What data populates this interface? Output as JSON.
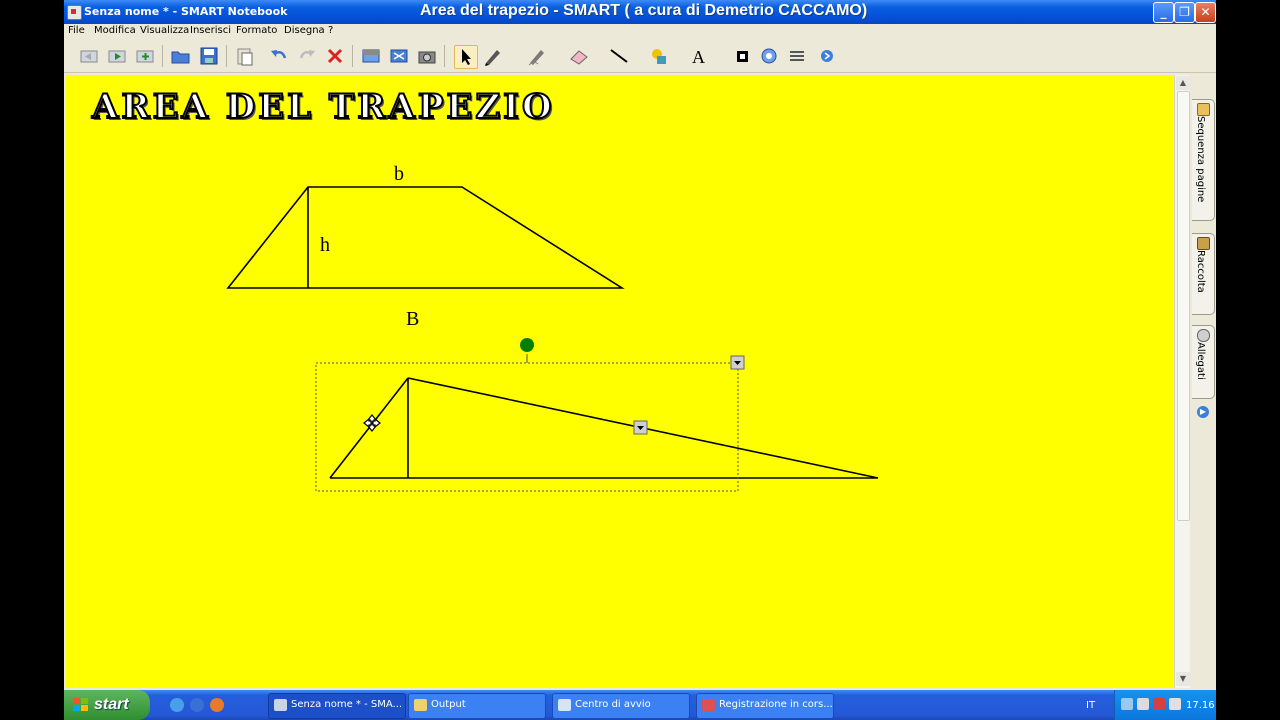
{
  "window": {
    "app_title": "Senza nome * - SMART Notebook",
    "title": "Area del trapezio - SMART ( a cura di Demetrio CACCAMO)",
    "controls": [
      "minimize",
      "maximize",
      "close"
    ]
  },
  "menu": [
    "File",
    "Modifica",
    "Visualizza",
    "Inserisci",
    "Formato",
    "Disegna",
    "?"
  ],
  "toolbar": {
    "icons": [
      "previous-page-icon",
      "next-page-icon",
      "add-page-icon",
      "open-icon",
      "save-icon",
      "paste-icon",
      "undo-icon",
      "redo-icon",
      "delete-icon",
      "screen-shade-icon",
      "full-screen-icon",
      "capture-icon",
      "select-icon",
      "pen-icon",
      "creative-pen-icon",
      "eraser-icon",
      "line-icon",
      "shapes-icon",
      "text-icon",
      "fill-icon",
      "properties-icon",
      "toolbar-move-icon",
      "more-icon"
    ]
  },
  "page": {
    "heading": "AREA DEL TRAPEZIO",
    "labels": {
      "b": "b",
      "h": "h",
      "B": "B"
    }
  },
  "sidebar": {
    "tabs": [
      "Sequenza pagine",
      "Raccolta",
      "Allegati"
    ]
  },
  "colors": {
    "canvas": "#ffff00",
    "title_bar": "#0a5fe0",
    "taskbar": "#245edb",
    "start": "#3c9a3c",
    "rotate_handle": "#008000"
  },
  "taskbar": {
    "start_label": "start",
    "tasks": [
      {
        "label": "Senza nome * - SMA...",
        "icon": "smart-notebook-icon",
        "active": true
      },
      {
        "label": "Output",
        "icon": "folder-icon",
        "active": false
      },
      {
        "label": "Centro di avvio",
        "icon": "launch-center-icon",
        "active": false
      },
      {
        "label": "Registrazione in cors...",
        "icon": "recorder-icon",
        "active": false
      }
    ],
    "language": "IT",
    "clock": "17.16"
  }
}
